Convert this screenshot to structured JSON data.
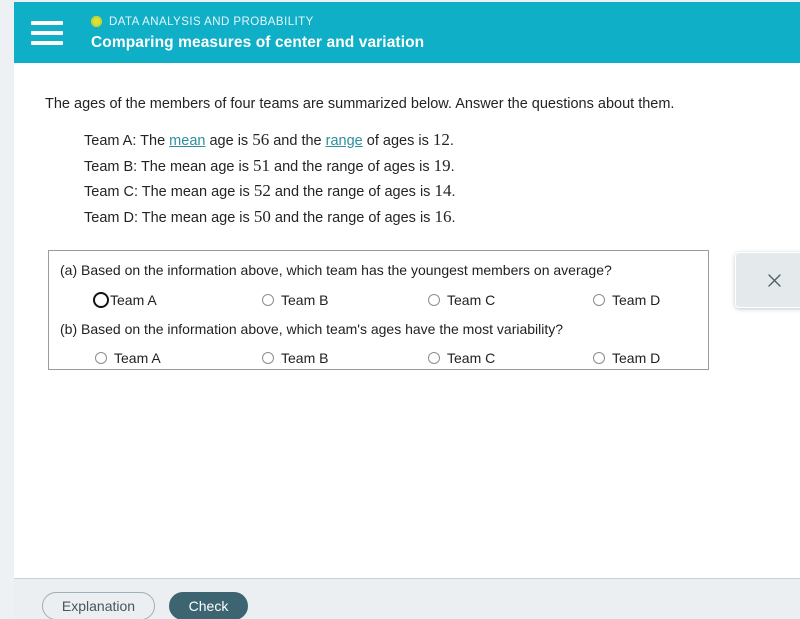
{
  "header": {
    "menu_icon": "hamburger-icon",
    "kicker_icon": "yellow-dot-icon",
    "kicker": "DATA ANALYSIS AND PROBABILITY",
    "title": "Comparing measures of center and variation",
    "collapse_icon": "chevron-down-icon"
  },
  "content": {
    "intro": "The ages of the members of four teams are summarized below. Answer the questions about them.",
    "teams": [
      {
        "prefix": "Team A: The ",
        "link1": "mean",
        "mid1": " age is ",
        "mean": "56",
        "mid2": " and the ",
        "link2": "range",
        "mid3": " of ages is ",
        "range": "12",
        "suffix": "."
      },
      {
        "prefix": "Team B: The ",
        "link1": "mean",
        "mid1": " age is ",
        "mean": "51",
        "mid2": " and the ",
        "link2": "range",
        "mid3": " of ages is ",
        "range": "19",
        "suffix": "."
      },
      {
        "prefix": "Team C: The ",
        "link1": "mean",
        "mid1": " age is ",
        "mean": "52",
        "mid2": " and the ",
        "link2": "range",
        "mid3": " of ages is ",
        "range": "14",
        "suffix": "."
      },
      {
        "prefix": "Team D: The ",
        "link1": "mean",
        "mid1": " age is ",
        "mean": "50",
        "mid2": " and the ",
        "link2": "range",
        "mid3": " of ages is ",
        "range": "16",
        "suffix": "."
      }
    ]
  },
  "questions": {
    "a": {
      "prompt": "(a) Based on the information above, which team has the youngest members on average?",
      "options": [
        "Team A",
        "Team B",
        "Team C",
        "Team D"
      ],
      "selected": null,
      "focused_index": 0
    },
    "b": {
      "prompt": "(b) Based on the information above, which team's ages have the most variability?",
      "options": [
        "Team A",
        "Team B",
        "Team C",
        "Team D"
      ],
      "selected": null,
      "focused_index": null
    }
  },
  "close_panel": {
    "icon": "close-x-icon"
  },
  "footer": {
    "explanation_label": "Explanation",
    "check_label": "Check"
  },
  "colors": {
    "header_teal": "#0fafc8",
    "collapse_tab": "#c3e6ef",
    "link_teal": "#2e8f9e",
    "kicker_dot": "#d8e23c",
    "check_button": "#3c6571",
    "footer_bg": "#eceff1"
  }
}
